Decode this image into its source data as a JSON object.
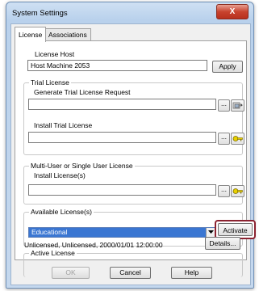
{
  "window": {
    "title": "System Settings",
    "close_glyph": "X"
  },
  "tabs": [
    {
      "label": "License",
      "active": true
    },
    {
      "label": "Associations",
      "active": false
    }
  ],
  "license_host": {
    "label": "License Host",
    "value": "Host Machine 2053",
    "apply_label": "Apply"
  },
  "trial_license": {
    "group_label": "Trial License",
    "generate_label": "Generate Trial License Request",
    "generate_value": "",
    "install_label": "Install Trial License",
    "install_value": "",
    "browse_label": "..."
  },
  "multi_user": {
    "group_label": "Multi-User or Single User License",
    "install_label": "Install License(s)",
    "install_value": "",
    "browse_label": "..."
  },
  "available": {
    "group_label": "Available License(s)",
    "selected": "Educational",
    "activate_label": "Activate"
  },
  "active_license": {
    "group_label": "Active License",
    "status": "Unlicensed,  Unlicensed,  2000/01/01 12:00:00",
    "details_label": "Details..."
  },
  "footer": {
    "ok_label": "OK",
    "cancel_label": "Cancel",
    "help_label": "Help"
  },
  "colors": {
    "activate_highlight": "#8b2230",
    "selection_blue": "#3a76d2"
  }
}
